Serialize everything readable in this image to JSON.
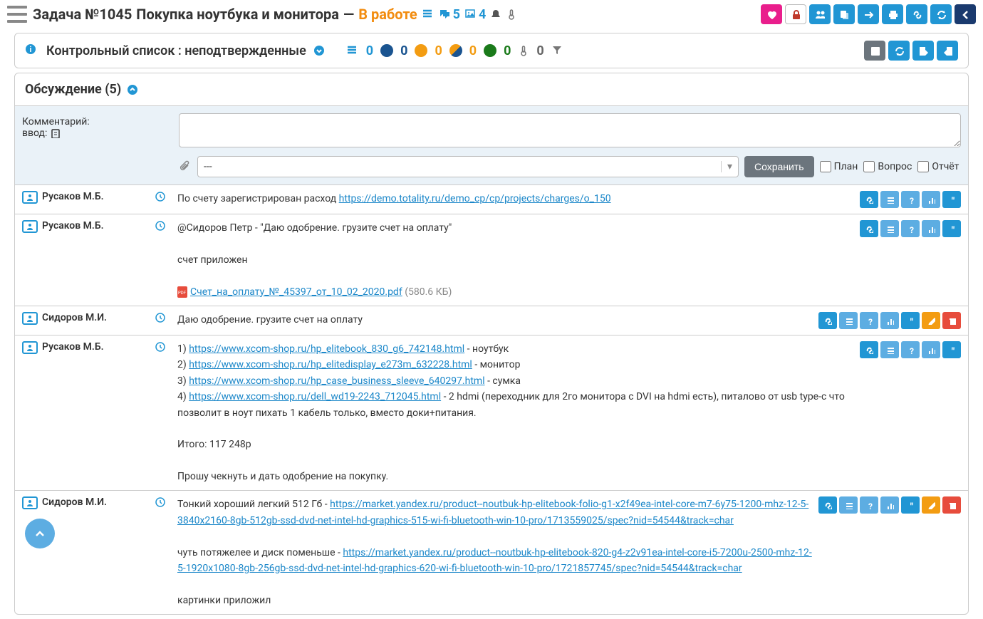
{
  "header": {
    "task_prefix": "Задача №1045",
    "task_name": "Покупка ноутбука и монитора",
    "sep": "—",
    "status": "В работе",
    "comments_count": "5",
    "images_count": "4"
  },
  "checklist": {
    "title": "Контрольный список : неподтвержденные",
    "counts": {
      "lines": "0",
      "darkblue": "0",
      "orange": "0",
      "half": "0",
      "green": "0",
      "therm": "0"
    }
  },
  "discussion": {
    "title": "Обсуждение (5)"
  },
  "form": {
    "label_line1": "Комментарий:",
    "label_line2": "ввод:",
    "select_placeholder": "---",
    "save": "Сохранить",
    "cb_plan": "План",
    "cb_question": "Вопрос",
    "cb_report": "Отчёт"
  },
  "comments": [
    {
      "author": "Русаков М.Б.",
      "body_html": "По счету зарегистрирован расход  <a href='#'>https://demo.totality.ru/demo_cp/cp/projects/charges/o_150</a>",
      "actions": "quote_light"
    },
    {
      "author": "Русаков М.Б.",
      "body_html": "@Сидоров Петр - \"Даю одобрение. грузите счет на оплату\"<br><br>счет приложен<br><br><span class='pdf-ico'></span><a href='#'>Счет_на_оплату_№_45397_от_10_02_2020.pdf</a>  <span class='file-size'>(580.6 КБ)</span>",
      "actions": "quote_light"
    },
    {
      "author": "Сидоров М.И.",
      "body_html": "Даю одобрение. грузите счет на оплату",
      "actions": "edit_full"
    },
    {
      "author": "Русаков М.Б.",
      "body_html": "1) <a href='#'>https://www.xcom-shop.ru/hp_elitebook_830_g6_742148.html</a> - ноутбук<br>2) <a href='#'>https://www.xcom-shop.ru/hp_elitedisplay_e273m_632228.html</a> - монитор<br>3) <a href='#'>https://www.xcom-shop.ru/hp_case_business_sleeve_640297.html</a> - сумка<br>4) <a href='#'>https://www.xcom-shop.ru/dell_wd19-2243_712045.html</a> - 2 hdmi (переходник для 2го монитора с DVI на hdmi есть), питалово от usb type-c что позволит в ноут пихать 1 кабель только, вместо доки+питания.<br><br>Итого: 117 248р<br><br>Прошу чекнуть и дать одобрение на покупку.",
      "actions": "quote_light"
    },
    {
      "author": "Сидоров М.И.",
      "body_html": "Тонкий хороший легкий 512 Гб - <a href='#'>https://market.yandex.ru/product--noutbuk-hp-elitebook-folio-g1-x2f49ea-intel-core-m7-6y75-1200-mhz-12-5-3840x2160-8gb-512gb-ssd-dvd-net-intel-hd-graphics-515-wi-fi-bluetooth-win-10-pro/1713559025/spec?nid=54544&track=char</a><br><br>чуть потяжелее и диск поменьше - <a href='#'>https://market.yandex.ru/product--noutbuk-hp-elitebook-820-g4-z2v91ea-intel-core-i5-7200u-2500-mhz-12-5-1920x1080-8gb-256gb-ssd-dvd-net-intel-hd-graphics-620-wi-fi-bluetooth-win-10-pro/1721857745/spec?nid=54544&track=char</a><br><br>картинки приложил",
      "actions": "edit_full"
    }
  ]
}
